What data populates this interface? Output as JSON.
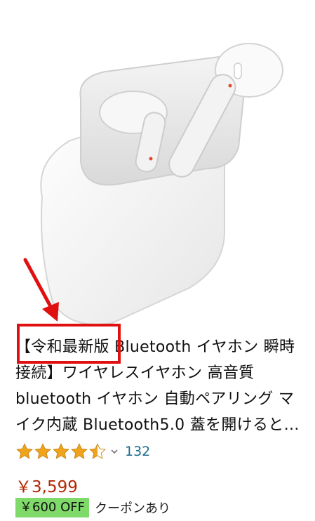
{
  "product": {
    "image_alt": "white wireless earbuds with charging case",
    "title": "【令和最新版 Bluetooth イヤホン 瞬時接続】ワイヤレスイヤホン 高音質 bluetooth イヤホン 自動ペアリング マイク内蔵 Bluetooth5.0 蓋を開けると自動接続",
    "rating": 4.5,
    "rating_max": 5,
    "review_count": "132",
    "price": "￥3,599",
    "coupon_badge": "￥600 OFF",
    "coupon_text": "クーポンあり"
  },
  "colors": {
    "star": "#f0a41d",
    "price": "#b12704",
    "coupon": "#7fda69",
    "annotation": "#e01010",
    "link": "#1a6a8a"
  }
}
